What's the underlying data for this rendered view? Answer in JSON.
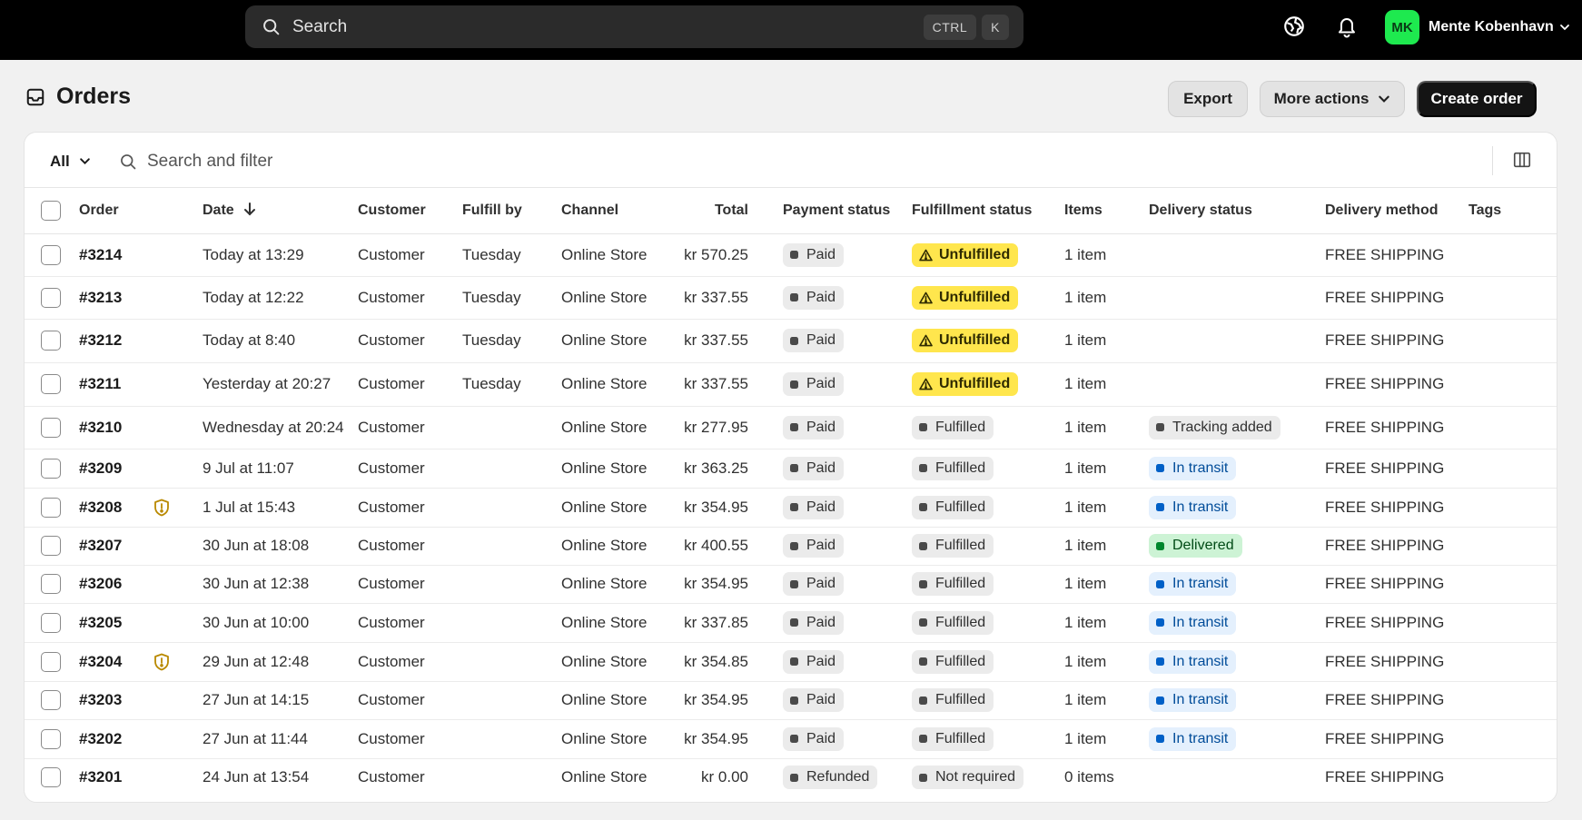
{
  "topbar": {
    "search_label": "Search",
    "shortcut_keys": [
      "CTRL",
      "K"
    ],
    "user_initials": "MK",
    "user_name": "Mente Kobenhavn",
    "icons": [
      "search-icon",
      "globe-icon",
      "bell-icon",
      "chevron-down-icon"
    ]
  },
  "page": {
    "title": "Orders",
    "title_icon": "inbox-icon",
    "buttons": {
      "export": "Export",
      "more_actions": "More actions",
      "create_order": "Create order"
    }
  },
  "filter": {
    "view": "All",
    "placeholder": "Search and filter"
  },
  "table": {
    "headers": {
      "order": "Order",
      "date": "Date",
      "customer": "Customer",
      "fulfill_by": "Fulfill by",
      "channel": "Channel",
      "total": "Total",
      "payment_status": "Payment status",
      "fulfillment_status": "Fulfillment status",
      "items": "Items",
      "delivery_status": "Delivery status",
      "delivery_method": "Delivery method",
      "tags": "Tags"
    },
    "rows": [
      {
        "order": "#3214",
        "risk": false,
        "date": "Today at 13:29",
        "customer": "Customer",
        "fulfill_by": "Tuesday",
        "channel": "Online Store",
        "total": "kr 570.25",
        "payment": "Paid",
        "fulfillment": "Unfulfilled",
        "items": "1 item",
        "delivery": "",
        "method": "FREE SHIPPING"
      },
      {
        "order": "#3213",
        "risk": false,
        "date": "Today at 12:22",
        "customer": "Customer",
        "fulfill_by": "Tuesday",
        "channel": "Online Store",
        "total": "kr 337.55",
        "payment": "Paid",
        "fulfillment": "Unfulfilled",
        "items": "1 item",
        "delivery": "",
        "method": "FREE SHIPPING"
      },
      {
        "order": "#3212",
        "risk": false,
        "date": "Today at 8:40",
        "customer": "Customer",
        "fulfill_by": "Tuesday",
        "channel": "Online Store",
        "total": "kr 337.55",
        "payment": "Paid",
        "fulfillment": "Unfulfilled",
        "items": "1 item",
        "delivery": "",
        "method": "FREE SHIPPING"
      },
      {
        "order": "#3211",
        "risk": false,
        "date": "Yesterday at 20:27",
        "customer": "Customer",
        "fulfill_by": "Tuesday",
        "channel": "Online Store",
        "total": "kr 337.55",
        "payment": "Paid",
        "fulfillment": "Unfulfilled",
        "items": "1 item",
        "delivery": "",
        "method": "FREE SHIPPING"
      },
      {
        "order": "#3210",
        "risk": false,
        "date": "Wednesday at 20:24",
        "customer": "Customer",
        "fulfill_by": "",
        "channel": "Online Store",
        "total": "kr 277.95",
        "payment": "Paid",
        "fulfillment": "Fulfilled",
        "items": "1 item",
        "delivery": "Tracking added",
        "method": "FREE SHIPPING"
      },
      {
        "order": "#3209",
        "risk": false,
        "date": "9 Jul at 11:07",
        "customer": "Customer",
        "fulfill_by": "",
        "channel": "Online Store",
        "total": "kr 363.25",
        "payment": "Paid",
        "fulfillment": "Fulfilled",
        "items": "1 item",
        "delivery": "In transit",
        "method": "FREE SHIPPING"
      },
      {
        "order": "#3208",
        "risk": true,
        "date": "1 Jul at 15:43",
        "customer": "Customer",
        "fulfill_by": "",
        "channel": "Online Store",
        "total": "kr 354.95",
        "payment": "Paid",
        "fulfillment": "Fulfilled",
        "items": "1 item",
        "delivery": "In transit",
        "method": "FREE SHIPPING"
      },
      {
        "order": "#3207",
        "risk": false,
        "date": "30 Jun at 18:08",
        "customer": "Customer",
        "fulfill_by": "",
        "channel": "Online Store",
        "total": "kr 400.55",
        "payment": "Paid",
        "fulfillment": "Fulfilled",
        "items": "1 item",
        "delivery": "Delivered",
        "method": "FREE SHIPPING"
      },
      {
        "order": "#3206",
        "risk": false,
        "date": "30 Jun at 12:38",
        "customer": "Customer",
        "fulfill_by": "",
        "channel": "Online Store",
        "total": "kr 354.95",
        "payment": "Paid",
        "fulfillment": "Fulfilled",
        "items": "1 item",
        "delivery": "In transit",
        "method": "FREE SHIPPING"
      },
      {
        "order": "#3205",
        "risk": false,
        "date": "30 Jun at 10:00",
        "customer": "Customer",
        "fulfill_by": "",
        "channel": "Online Store",
        "total": "kr 337.85",
        "payment": "Paid",
        "fulfillment": "Fulfilled",
        "items": "1 item",
        "delivery": "In transit",
        "method": "FREE SHIPPING"
      },
      {
        "order": "#3204",
        "risk": true,
        "date": "29 Jun at 12:48",
        "customer": "Customer",
        "fulfill_by": "",
        "channel": "Online Store",
        "total": "kr 354.85",
        "payment": "Paid",
        "fulfillment": "Fulfilled",
        "items": "1 item",
        "delivery": "In transit",
        "method": "FREE SHIPPING"
      },
      {
        "order": "#3203",
        "risk": false,
        "date": "27 Jun at 14:15",
        "customer": "Customer",
        "fulfill_by": "",
        "channel": "Online Store",
        "total": "kr 354.95",
        "payment": "Paid",
        "fulfillment": "Fulfilled",
        "items": "1 item",
        "delivery": "In transit",
        "method": "FREE SHIPPING"
      },
      {
        "order": "#3202",
        "risk": false,
        "date": "27 Jun at 11:44",
        "customer": "Customer",
        "fulfill_by": "",
        "channel": "Online Store",
        "total": "kr 354.95",
        "payment": "Paid",
        "fulfillment": "Fulfilled",
        "items": "1 item",
        "delivery": "In transit",
        "method": "FREE SHIPPING"
      },
      {
        "order": "#3201",
        "risk": false,
        "date": "24 Jun at 13:54",
        "customer": "Customer",
        "fulfill_by": "",
        "channel": "Online Store",
        "total": "kr 0.00",
        "payment": "Refunded",
        "fulfillment": "Not required",
        "items": "0 items",
        "delivery": "",
        "method": "FREE SHIPPING"
      }
    ]
  },
  "colors": {
    "topbar_bg": "#000000",
    "primary_button": "#141414",
    "unfulfilled_bg": "#ffe64d",
    "in_transit_bg": "#e4f0fd",
    "in_transit_text": "#004c99",
    "delivered_bg": "#cdf3d5",
    "avatar_bg": "#1ee94f",
    "risk_icon": "#b98900"
  }
}
